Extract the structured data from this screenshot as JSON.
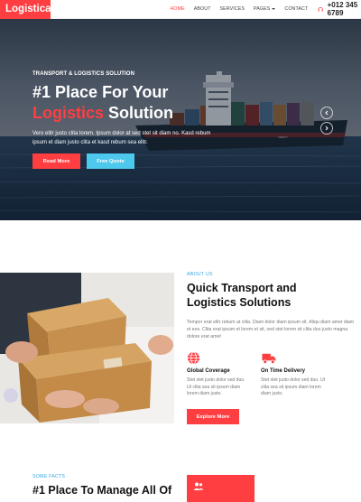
{
  "nav": {
    "brand": "Logistica",
    "items": [
      {
        "label": "HOME",
        "active": true
      },
      {
        "label": "ABOUT"
      },
      {
        "label": "SERVICES"
      },
      {
        "label": "PAGES",
        "dropdown": true
      },
      {
        "label": "CONTACT"
      }
    ],
    "phone": "+012 345 6789",
    "phone_icon": "headset-icon"
  },
  "hero": {
    "kicker": "TRANSPORT & LOGISTICS SOLUTION",
    "title_line1": "#1 Place For Your",
    "title_red": "Logistics",
    "title_rest": " Solution",
    "description": "Vero elitr justo clita lorem. Ipsum dolor at sed stet sit diam no. Kasd rebum ipsum et diam justo clita et kasd rebum sea elitr.",
    "primary_button": "Read More",
    "secondary_button": "Free Quote",
    "prev_icon": "chevron-left-icon",
    "next_icon": "chevron-right-icon"
  },
  "about": {
    "kicker": "ABOUT US",
    "title": "Quick Transport and Logistics Solutions",
    "text": "Tempor erat elitr rebum at clita. Diam dolor diam ipsum sit. Aliqu diam amet diam et eos. Clita erat ipsum et lorem et sit, sed stet lorem sit clita duo justo magna dolore erat amet",
    "features": [
      {
        "icon": "globe-icon",
        "title": "Global Coverage",
        "text": "Stet stet justo dolor sed duo. Ut clita sea sit ipsum diam lorem diam justo."
      },
      {
        "icon": "truck-icon",
        "title": "On Time Delivery",
        "text": "Stet stet justo dolor sed duo. Ut clita sea sit ipsum diam lorem diam justo."
      }
    ],
    "button": "Explore More"
  },
  "facts": {
    "kicker": "SOME FACTS",
    "title": "#1 Place To Manage All Of",
    "box_icon": "users-icon"
  },
  "colors": {
    "accent": "#ff3e41",
    "secondary": "#4ec9ee",
    "kicker": "#3ba5e0"
  }
}
